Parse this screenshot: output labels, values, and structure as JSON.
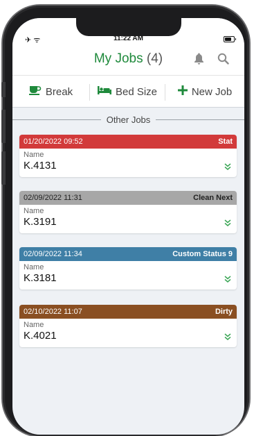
{
  "status_bar": {
    "left_icons": "✈ ᯤ",
    "time": "11:22 AM"
  },
  "header": {
    "title": "My Jobs",
    "count": "(4)"
  },
  "toolbar": {
    "break_label": "Break",
    "bed_size_label": "Bed Size",
    "new_job_label": "New Job"
  },
  "section": {
    "label": "Other Jobs"
  },
  "jobs": [
    {
      "datetime": "01/20/2022 09:52",
      "status": "Stat",
      "name_label": "Name",
      "name": "K.4131",
      "color": "#d23a3a",
      "text_color": "#ffffff"
    },
    {
      "datetime": "02/09/2022 11:31",
      "status": "Clean Next",
      "name_label": "Name",
      "name": "K.3191",
      "color": "#a7a7a7",
      "text_color": "#222222"
    },
    {
      "datetime": "02/09/2022 11:34",
      "status": "Custom Status 9",
      "name_label": "Name",
      "name": "K.3181",
      "color": "#3f7fa6",
      "text_color": "#ffffff"
    },
    {
      "datetime": "02/10/2022 11:07",
      "status": "Dirty",
      "name_label": "Name",
      "name": "K.4021",
      "color": "#8a4f22",
      "text_color": "#ffffff"
    }
  ],
  "colors": {
    "accent": "#1f8a3c",
    "background": "#eef1f5"
  }
}
